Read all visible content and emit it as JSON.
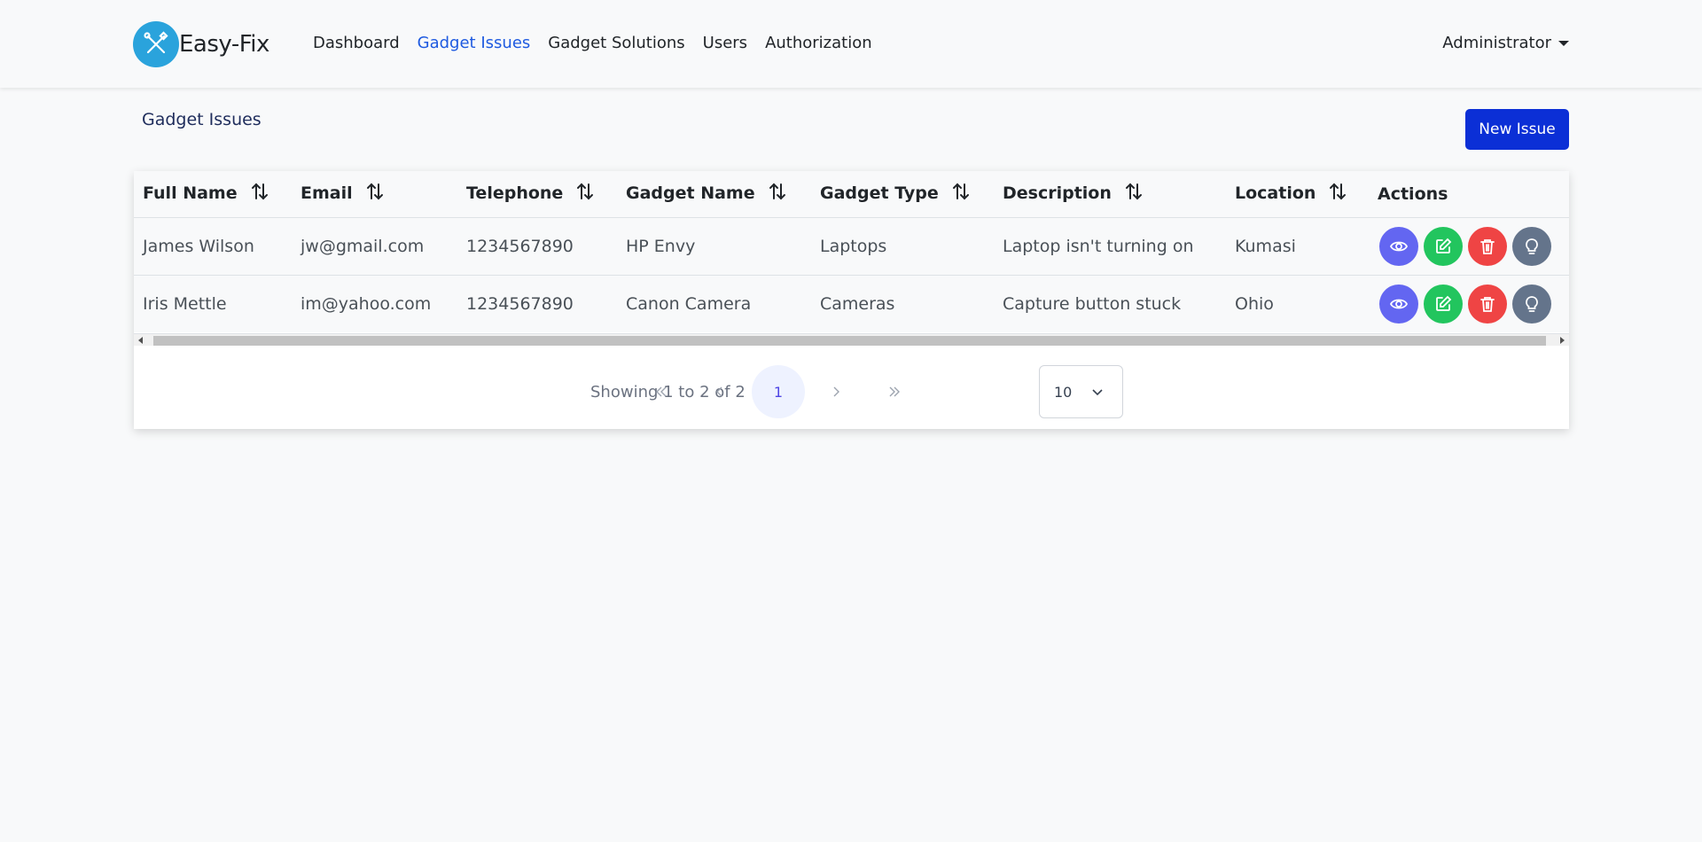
{
  "brand": {
    "name": "Easy-Fix",
    "logo_icon": "tools-icon",
    "logo_color": "#2aa3dc"
  },
  "nav": {
    "links": [
      {
        "label": "Dashboard",
        "active": false
      },
      {
        "label": "Gadget Issues",
        "active": true
      },
      {
        "label": "Gadget Solutions",
        "active": false
      },
      {
        "label": "Users",
        "active": false
      },
      {
        "label": "Authorization",
        "active": false
      }
    ],
    "user_menu": "Administrator"
  },
  "page": {
    "title": "Gadget Issues",
    "new_button": "New Issue"
  },
  "table": {
    "columns": [
      "Full Name",
      "Email",
      "Telephone",
      "Gadget Name",
      "Gadget Type",
      "Description",
      "Location",
      "Actions"
    ],
    "rows": [
      [
        "James Wilson",
        "jw@gmail.com",
        "1234567890",
        "HP Envy",
        "Laptops",
        "Laptop isn't turning on",
        "Kumasi"
      ],
      [
        "Iris Mettle",
        "im@yahoo.com",
        "1234567890",
        "Canon Camera",
        "Cameras",
        "Capture button stuck",
        "Ohio"
      ]
    ],
    "action_icons": [
      "eye-icon",
      "edit-icon",
      "trash-icon",
      "lightbulb-icon"
    ]
  },
  "paginator": {
    "report": "Showing 1 to 2 of 2",
    "current_page": "1",
    "rows_per_page": "10"
  },
  "colors": {
    "accent": "#1e5ae0",
    "primary_button": "#0b2fd6",
    "view": "#6366f1",
    "edit": "#22c55e",
    "delete": "#ef4444",
    "solution": "#64748b"
  }
}
